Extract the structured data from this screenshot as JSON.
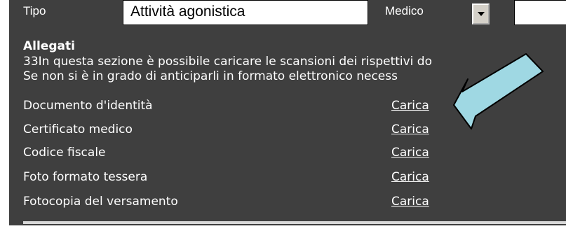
{
  "form": {
    "tipo_label": "Tipo",
    "tipo_value": "Attività agonistica",
    "medico_label": "Medico"
  },
  "allegati": {
    "title": "Allegati",
    "desc_line1": "33In questa sezione è possibile caricare le scansioni dei rispettivi do",
    "desc_line2": "Se non si è in grado di anticiparli in formato elettronico necess",
    "items": [
      {
        "label": "Documento d'identità",
        "action": "Carica"
      },
      {
        "label": "Certificato medico",
        "action": "Carica"
      },
      {
        "label": "Codice fiscale",
        "action": "Carica"
      },
      {
        "label": "Foto formato tessera",
        "action": "Carica"
      },
      {
        "label": "Fotocopia del versamento",
        "action": "Carica"
      }
    ]
  },
  "colors": {
    "panel_bg": "#3f3f3f",
    "text": "#ffffff",
    "arrow_fill": "#9fd8e3",
    "arrow_stroke": "#000000"
  },
  "icons": {
    "select_arrow": "dropdown-arrow-icon",
    "annotation": "pointer-arrow-annotation"
  }
}
